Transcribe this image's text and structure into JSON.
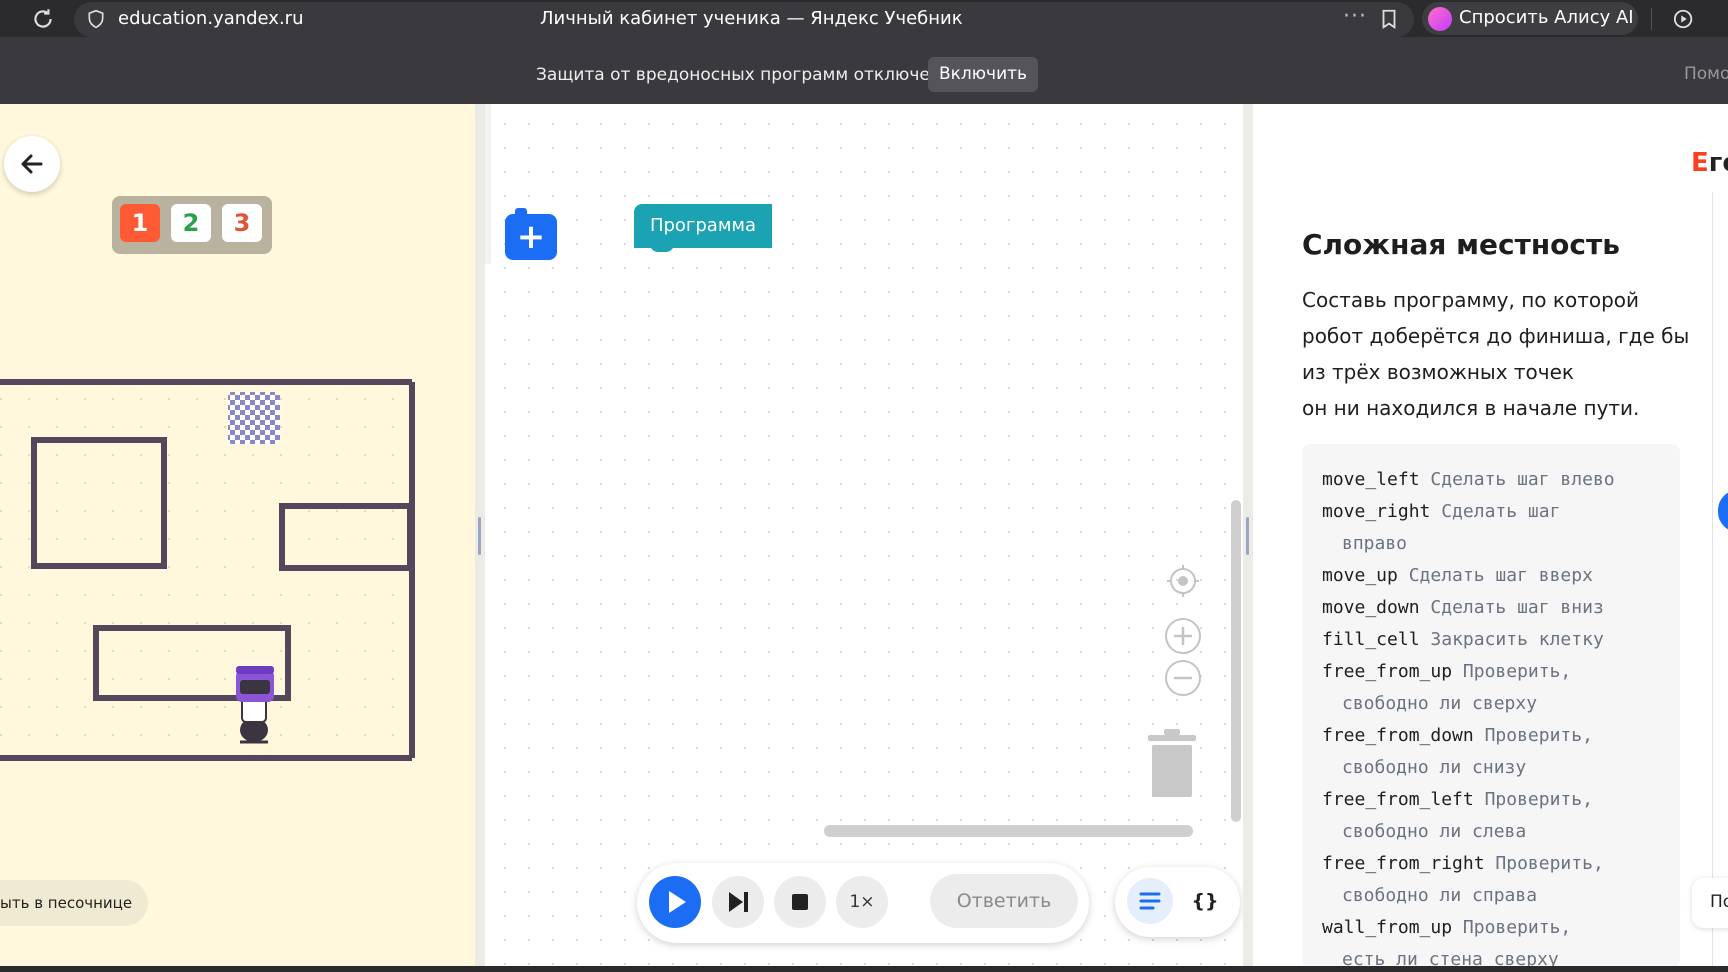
{
  "browser": {
    "url": "education.yandex.ru",
    "tab_title": "Личный кабинет ученика — Яндекс Учебник",
    "more_dots": "···",
    "alice_button": "Спросить Алису AI"
  },
  "infobar": {
    "message": "Защита от вредоносных программ отключена",
    "enable_button": "Включить",
    "help_link": "Помо"
  },
  "game": {
    "levels": [
      "1",
      "2",
      "3"
    ],
    "sandbox_button": "ыть в песочнице"
  },
  "workspace": {
    "add_label": "+",
    "program_block": "Программа",
    "speed": "1×",
    "answer_button": "Ответить",
    "code_view": "{}"
  },
  "task": {
    "brand_first": "Е",
    "brand_rest": "го",
    "title": "Сложная местность",
    "text_lines": [
      "Составь программу, по которой",
      "робот доберётся до финиша, где бы",
      "из трёх возможных точек",
      "он ни находился в начале пути."
    ],
    "commands": [
      {
        "name": "move_left",
        "desc": "Сделать шаг влево",
        "cont": ""
      },
      {
        "name": "move_right",
        "desc": "Сделать шаг",
        "cont": "вправо"
      },
      {
        "name": "move_up",
        "desc": "Сделать шаг вверх",
        "cont": ""
      },
      {
        "name": "move_down",
        "desc": "Сделать шаг вниз",
        "cont": ""
      },
      {
        "name": "fill_cell",
        "desc": "Закрасить клетку",
        "cont": ""
      },
      {
        "name": "free_from_up",
        "desc": "Проверить,",
        "cont": "свободно ли сверху"
      },
      {
        "name": "free_from_down",
        "desc": "Проверить,",
        "cont": "свободно ли снизу"
      },
      {
        "name": "free_from_left",
        "desc": "Проверить,",
        "cont": "свободно ли слева"
      },
      {
        "name": "free_from_right",
        "desc": "Проверить,",
        "cont": "свободно ли справа"
      },
      {
        "name": "wall_from_up",
        "desc": "Проверить,",
        "cont": "есть ли стена сверху"
      }
    ],
    "side_tab": "По"
  },
  "colors": {
    "accent_blue": "#1b6ef3",
    "program_teal": "#1ba3b3",
    "level_active": "#ff5a33",
    "yandex_red": "#fc3f1d",
    "game_bg": "#fff8dc"
  }
}
